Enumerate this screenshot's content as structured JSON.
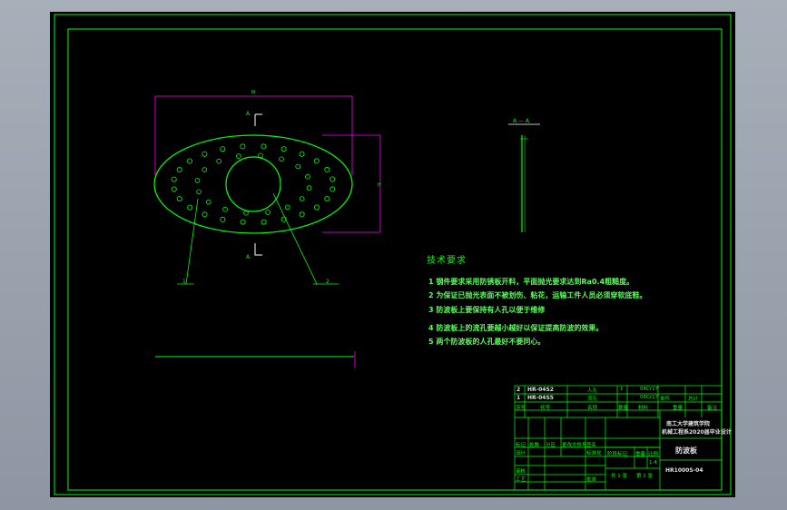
{
  "drawing": {
    "section_label": "A — A",
    "view_marker_top": "A",
    "view_marker_bottom": "A",
    "leader_1": "1",
    "leader_2": "2",
    "dim_width": "W",
    "dim_height": "H"
  },
  "tech_requirements": {
    "title": "技术要求",
    "items": [
      "1  钢件要求采用防锈板开料，平面抛光要求达到Ra0.4粗糙度。",
      "2  为保证已抛光表面不被划伤、粘花，运输工件人员必须穿软底鞋。",
      "3   防波板上要保持有人孔以便于维修",
      "4  防波板上的流孔要越小越好以保证提高防波的效果。",
      "5  两个防波板的人孔最好不要同心。"
    ]
  },
  "parts_table": {
    "rows": [
      {
        "no": "2",
        "code": "HR-04S2",
        "name": "人孔",
        "qty": "1",
        "material": "06Cr17"
      },
      {
        "no": "1",
        "code": "HR-04S5",
        "name": "流孔",
        "qty": "",
        "material": "06Cr17"
      }
    ],
    "header": {
      "no": "序号",
      "code": "代号",
      "name": "名称",
      "qty": "数量",
      "material": "材料",
      "unit_weight": "单件",
      "total_weight": "总计",
      "weight": "重量",
      "remark": "备注"
    }
  },
  "title_block": {
    "institution_1": "南工大学建筑学院",
    "institution_2": "机械工程系2020届毕业设计",
    "part_name": "防波板",
    "drawing_no": "HR1000S-04",
    "mark": "标记",
    "count": "处数",
    "zone": "分区",
    "change_doc": "更改文件号",
    "sign": "签名",
    "date": "年月日",
    "design": "设计",
    "standardize": "标准化",
    "check": "审核",
    "craft": "工艺",
    "approve": "批准",
    "stage_mark": "阶段标记",
    "weight": "重量",
    "scale": "比例",
    "scale_value": "1:4",
    "sheets_total": "共 1 张",
    "sheet_no": "第 1 张"
  },
  "colors": {
    "background": "#000000",
    "lines": "#00ff00",
    "dimensions": "#ff00ff",
    "text": "#00ff00",
    "frame_bg": "#9aa2ad"
  }
}
